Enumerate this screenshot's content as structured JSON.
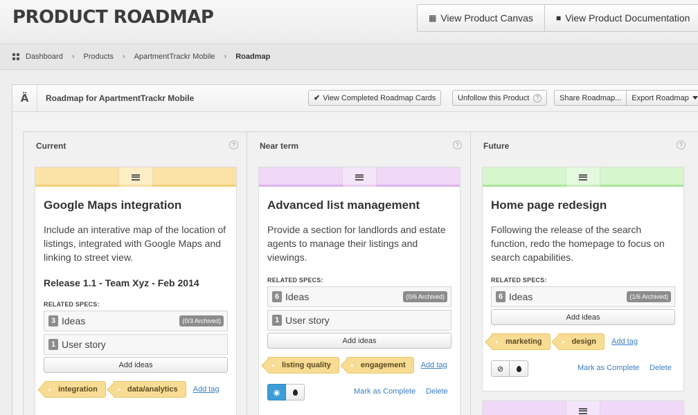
{
  "header": {
    "title": "PRODUCT ROADMAP",
    "buttons": [
      {
        "label": "View Product Canvas",
        "icon": "grid-icon"
      },
      {
        "label": "View Product Documentation",
        "icon": "briefcase-icon"
      }
    ]
  },
  "breadcrumb": {
    "items": [
      "Dashboard",
      "Products",
      "ApartmentTrackr Mobile"
    ],
    "current": "Roadmap"
  },
  "panel": {
    "title": "Roadmap for ApartmentTrackr Mobile",
    "view_completed": "View Completed Roadmap Cards",
    "unfollow": "Unfollow this Product",
    "share": "Share Roadmap...",
    "export": "Export Roadmap",
    "help_glyph": "?"
  },
  "columns": [
    {
      "title": "Current",
      "card": {
        "accent": "#fbe3a6",
        "accent_border": "#f4cf78",
        "title": "Google Maps integration",
        "description": "Include an interative map of the location of listings, integrated with Google Maps and linking to street view.",
        "release": "Release 1.1 - Team Xyz - Feb 2014",
        "specs_label": "RELATED SPECS:",
        "specs": [
          {
            "count": "3",
            "name": "Ideas",
            "archived": "(0/3 Archived)"
          },
          {
            "count": "1",
            "name": "User story",
            "archived": ""
          }
        ],
        "add_ideas": "Add ideas",
        "tags": [
          "integration",
          "data/analytics"
        ],
        "add_tag": "Add tag"
      }
    },
    {
      "title": "Near term",
      "card": {
        "accent": "#efd8f8",
        "accent_border": "#dcb4ec",
        "title": "Advanced list management",
        "description": "Provide a section for landlords and estate agents to manage their listings and viewings.",
        "specs_label": "RELATED SPECS:",
        "specs": [
          {
            "count": "6",
            "name": "Ideas",
            "archived": "(0/6 Archived)"
          },
          {
            "count": "1",
            "name": "User story",
            "archived": ""
          }
        ],
        "add_ideas": "Add ideas",
        "tags": [
          "listing quality",
          "engagement"
        ],
        "add_tag": "Add tag",
        "mark_complete": "Mark as Complete",
        "delete": "Delete"
      }
    },
    {
      "title": "Future",
      "card": {
        "accent": "#d6f6cd",
        "accent_border": "#a9e59a",
        "title": "Home page redesign",
        "description": "Following the release of the search function, redo the homepage to focus on search capabilities.",
        "specs_label": "RELATED SPECS:",
        "specs": [
          {
            "count": "6",
            "name": "Ideas",
            "archived": "(1/6 Archived)"
          }
        ],
        "add_ideas": "Add ideas",
        "tags": [
          "marketing",
          "design"
        ],
        "add_tag": "Add tag",
        "mark_complete": "Mark as Complete",
        "delete": "Delete"
      }
    }
  ]
}
